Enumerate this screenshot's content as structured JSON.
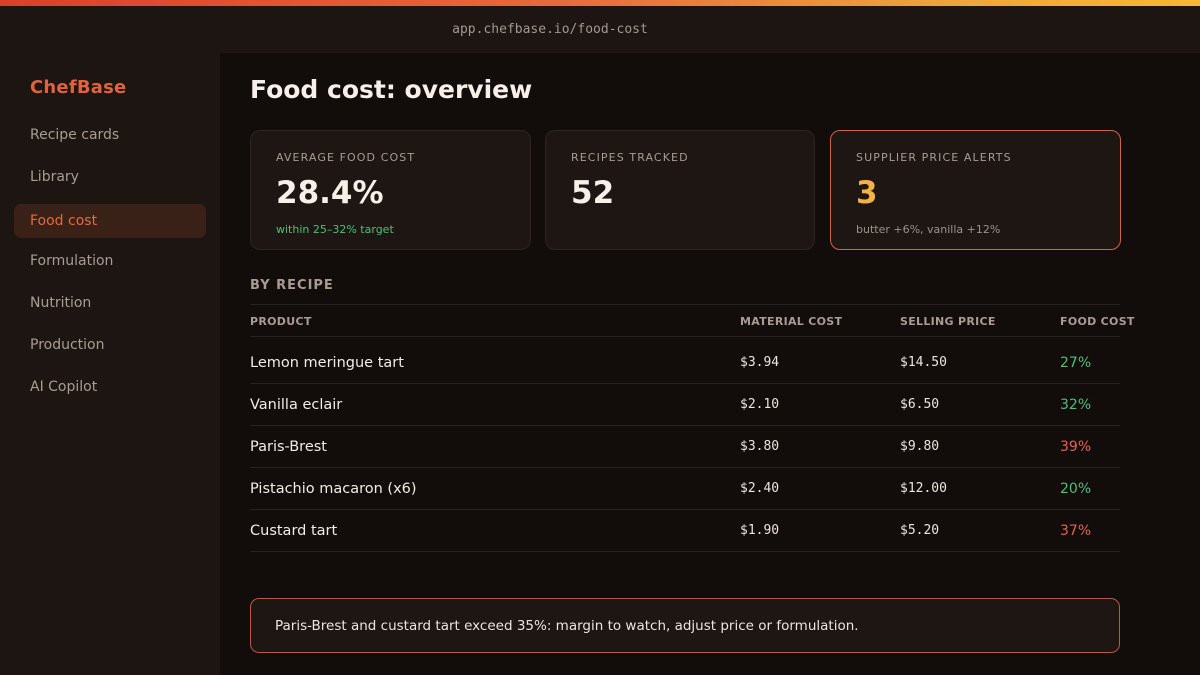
{
  "browser": {
    "url": "app.chefbase.io/food-cost"
  },
  "sidebar": {
    "brand": "ChefBase",
    "items": [
      {
        "label": "Recipe cards",
        "active": false
      },
      {
        "label": "Library",
        "active": false
      },
      {
        "label": "Food cost",
        "active": true
      },
      {
        "label": "Formulation",
        "active": false
      },
      {
        "label": "Nutrition",
        "active": false
      },
      {
        "label": "Production",
        "active": false
      },
      {
        "label": "AI Copilot",
        "active": false
      }
    ]
  },
  "page": {
    "title": "Food cost: overview"
  },
  "cards": [
    {
      "label": "AVERAGE FOOD COST",
      "value": "28.4%",
      "sub": "within 25–32% target",
      "status": "ok"
    },
    {
      "label": "RECIPES TRACKED",
      "value": "52",
      "sub": "",
      "status": "neutral"
    },
    {
      "label": "SUPPLIER PRICE ALERTS",
      "value": "3",
      "sub": "butter +6%, vanilla +12%",
      "status": "alert"
    }
  ],
  "table": {
    "section_title": "BY RECIPE",
    "columns": [
      "PRODUCT",
      "MATERIAL COST",
      "SELLING PRICE",
      "FOOD COST"
    ],
    "rows": [
      {
        "product": "Lemon meringue tart",
        "material_cost": "$3.94",
        "selling_price": "$14.50",
        "food_cost": "27%",
        "status": "good"
      },
      {
        "product": "Vanilla eclair",
        "material_cost": "$2.10",
        "selling_price": "$6.50",
        "food_cost": "32%",
        "status": "good"
      },
      {
        "product": "Paris-Brest",
        "material_cost": "$3.80",
        "selling_price": "$9.80",
        "food_cost": "39%",
        "status": "bad"
      },
      {
        "product": "Pistachio macaron (x6)",
        "material_cost": "$2.40",
        "selling_price": "$12.00",
        "food_cost": "20%",
        "status": "good"
      },
      {
        "product": "Custard tart",
        "material_cost": "$1.90",
        "selling_price": "$5.20",
        "food_cost": "37%",
        "status": "bad"
      }
    ]
  },
  "notice": {
    "text": "Paris-Brest and custard tart exceed 35%: margin to watch, adjust price or formulation."
  },
  "colors": {
    "accent": "#e2623d",
    "good": "#4fbf7a",
    "bad": "#e8624f",
    "warning": "#f2b244",
    "background": "#120c0a",
    "panel": "#1c1512"
  }
}
